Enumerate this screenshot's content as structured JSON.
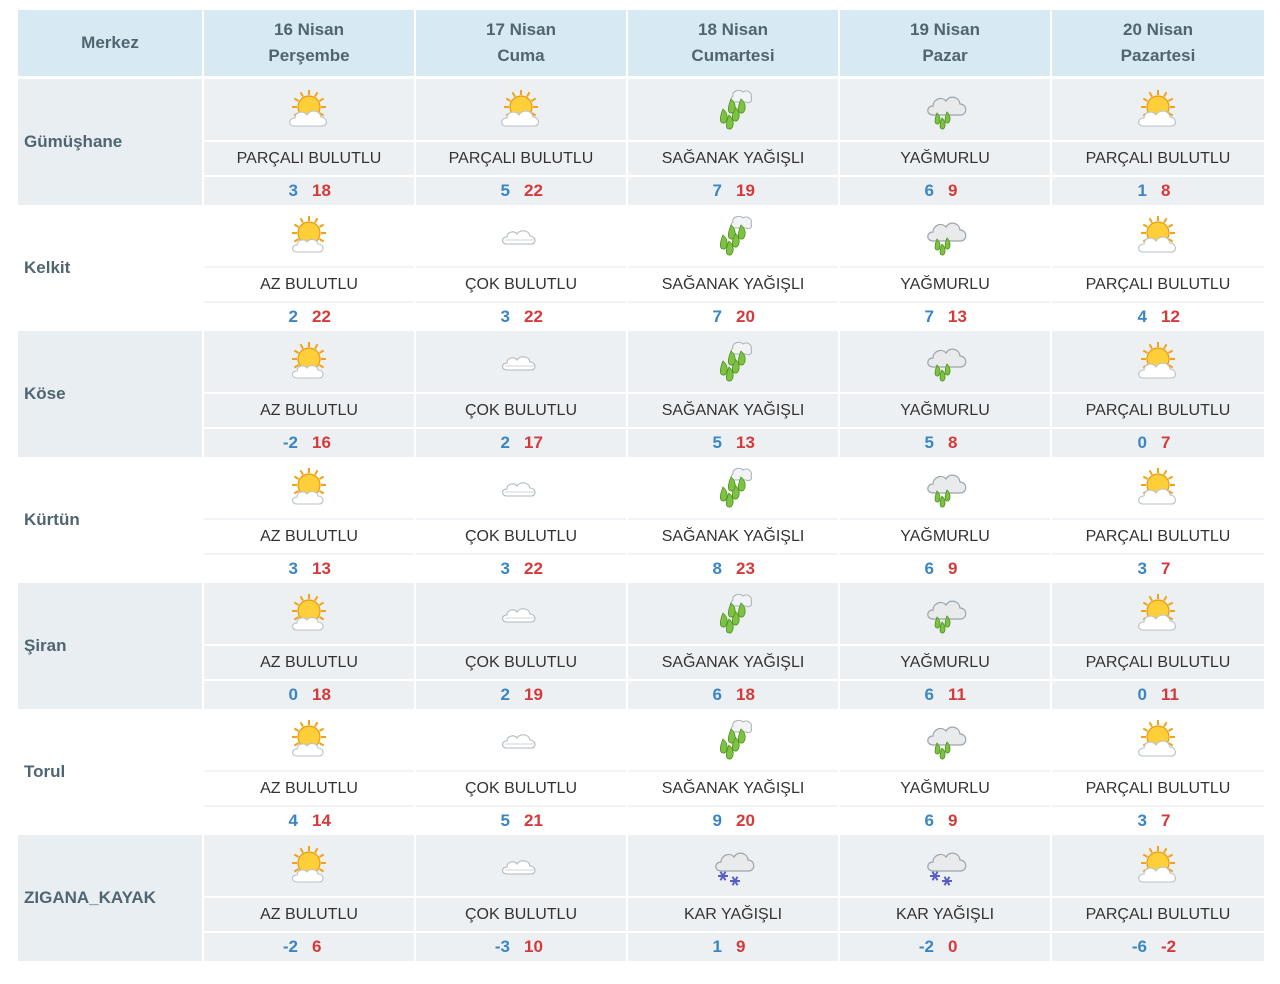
{
  "header": {
    "city_col": "Merkez",
    "days": [
      {
        "date": "16 Nisan",
        "weekday": "Perşembe"
      },
      {
        "date": "17 Nisan",
        "weekday": "Cuma"
      },
      {
        "date": "18 Nisan",
        "weekday": "Cumartesi"
      },
      {
        "date": "19 Nisan",
        "weekday": "Pazar"
      },
      {
        "date": "20 Nisan",
        "weekday": "Pazartesi"
      }
    ]
  },
  "rows": [
    {
      "city": "Gümüşhane",
      "days": [
        {
          "icon": "partly-cloudy-icon",
          "desc": "PARÇALI BULUTLU",
          "min": "3",
          "max": "18"
        },
        {
          "icon": "partly-cloudy-icon",
          "desc": "PARÇALI BULUTLU",
          "min": "5",
          "max": "22"
        },
        {
          "icon": "showers-icon",
          "desc": "SAĞANAK YAĞIŞLI",
          "min": "7",
          "max": "19"
        },
        {
          "icon": "rain-icon",
          "desc": "YAĞMURLU",
          "min": "6",
          "max": "9"
        },
        {
          "icon": "partly-cloudy-icon",
          "desc": "PARÇALI BULUTLU",
          "min": "1",
          "max": "8"
        }
      ]
    },
    {
      "city": "Kelkit",
      "days": [
        {
          "icon": "mostly-sunny-icon",
          "desc": "AZ BULUTLU",
          "min": "2",
          "max": "22"
        },
        {
          "icon": "cloudy-icon",
          "desc": "ÇOK BULUTLU",
          "min": "3",
          "max": "22"
        },
        {
          "icon": "showers-icon",
          "desc": "SAĞANAK YAĞIŞLI",
          "min": "7",
          "max": "20"
        },
        {
          "icon": "rain-icon",
          "desc": "YAĞMURLU",
          "min": "7",
          "max": "13"
        },
        {
          "icon": "partly-cloudy-icon",
          "desc": "PARÇALI BULUTLU",
          "min": "4",
          "max": "12"
        }
      ]
    },
    {
      "city": "Köse",
      "days": [
        {
          "icon": "mostly-sunny-icon",
          "desc": "AZ BULUTLU",
          "min": "-2",
          "max": "16"
        },
        {
          "icon": "cloudy-icon",
          "desc": "ÇOK BULUTLU",
          "min": "2",
          "max": "17"
        },
        {
          "icon": "showers-icon",
          "desc": "SAĞANAK YAĞIŞLI",
          "min": "5",
          "max": "13"
        },
        {
          "icon": "rain-icon",
          "desc": "YAĞMURLU",
          "min": "5",
          "max": "8"
        },
        {
          "icon": "partly-cloudy-icon",
          "desc": "PARÇALI BULUTLU",
          "min": "0",
          "max": "7"
        }
      ]
    },
    {
      "city": "Kürtün",
      "days": [
        {
          "icon": "mostly-sunny-icon",
          "desc": "AZ BULUTLU",
          "min": "3",
          "max": "13"
        },
        {
          "icon": "cloudy-icon",
          "desc": "ÇOK BULUTLU",
          "min": "3",
          "max": "22"
        },
        {
          "icon": "showers-icon",
          "desc": "SAĞANAK YAĞIŞLI",
          "min": "8",
          "max": "23"
        },
        {
          "icon": "rain-icon",
          "desc": "YAĞMURLU",
          "min": "6",
          "max": "9"
        },
        {
          "icon": "partly-cloudy-icon",
          "desc": "PARÇALI BULUTLU",
          "min": "3",
          "max": "7"
        }
      ]
    },
    {
      "city": "Şiran",
      "days": [
        {
          "icon": "mostly-sunny-icon",
          "desc": "AZ BULUTLU",
          "min": "0",
          "max": "18"
        },
        {
          "icon": "cloudy-icon",
          "desc": "ÇOK BULUTLU",
          "min": "2",
          "max": "19"
        },
        {
          "icon": "showers-icon",
          "desc": "SAĞANAK YAĞIŞLI",
          "min": "6",
          "max": "18"
        },
        {
          "icon": "rain-icon",
          "desc": "YAĞMURLU",
          "min": "6",
          "max": "11"
        },
        {
          "icon": "partly-cloudy-icon",
          "desc": "PARÇALI BULUTLU",
          "min": "0",
          "max": "11"
        }
      ]
    },
    {
      "city": "Torul",
      "days": [
        {
          "icon": "mostly-sunny-icon",
          "desc": "AZ BULUTLU",
          "min": "4",
          "max": "14"
        },
        {
          "icon": "cloudy-icon",
          "desc": "ÇOK BULUTLU",
          "min": "5",
          "max": "21"
        },
        {
          "icon": "showers-icon",
          "desc": "SAĞANAK YAĞIŞLI",
          "min": "9",
          "max": "20"
        },
        {
          "icon": "rain-icon",
          "desc": "YAĞMURLU",
          "min": "6",
          "max": "9"
        },
        {
          "icon": "partly-cloudy-icon",
          "desc": "PARÇALI BULUTLU",
          "min": "3",
          "max": "7"
        }
      ]
    },
    {
      "city": "ZIGANA_KAYAK",
      "days": [
        {
          "icon": "mostly-sunny-icon",
          "desc": "AZ BULUTLU",
          "min": "-2",
          "max": "6"
        },
        {
          "icon": "cloudy-icon",
          "desc": "ÇOK BULUTLU",
          "min": "-3",
          "max": "10"
        },
        {
          "icon": "snow-icon",
          "desc": "KAR YAĞIŞLI",
          "min": "1",
          "max": "9"
        },
        {
          "icon": "snow-icon",
          "desc": "KAR YAĞIŞLI",
          "min": "-2",
          "max": "0"
        },
        {
          "icon": "partly-cloudy-icon",
          "desc": "PARÇALI BULUTLU",
          "min": "-6",
          "max": "-2"
        }
      ]
    }
  ],
  "colors": {
    "header_bg": "#d7e9f2",
    "header_text": "#4f6670",
    "row_gray_bg": "#edf0f3",
    "min_temp": "#3a86c4",
    "max_temp": "#d43a3a"
  }
}
